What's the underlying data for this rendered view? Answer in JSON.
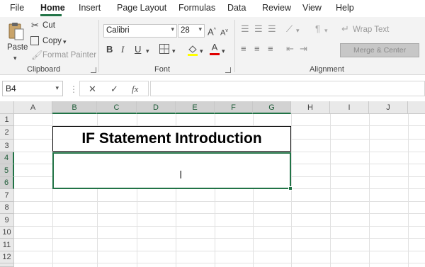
{
  "menu": {
    "tabs": [
      "File",
      "Home",
      "Insert",
      "Page Layout",
      "Formulas",
      "Data",
      "Review",
      "View",
      "Help"
    ],
    "active": "Home"
  },
  "ribbon": {
    "clipboard": {
      "paste": "Paste",
      "cut": "Cut",
      "copy": "Copy",
      "format_painter": "Format Painter",
      "label": "Clipboard"
    },
    "font": {
      "name": "Calibri",
      "size": "28",
      "bold": "B",
      "italic": "I",
      "underline": "U",
      "font_color_glyph": "A",
      "label": "Font"
    },
    "alignment": {
      "wrap_text": "Wrap Text",
      "merge_center": "Merge & Center",
      "label": "Alignment"
    }
  },
  "formula_bar": {
    "name_box": "B4",
    "cancel": "✕",
    "enter": "✓",
    "fx": "fx",
    "value": ""
  },
  "grid": {
    "columns": [
      "A",
      "B",
      "C",
      "D",
      "E",
      "F",
      "G",
      "H",
      "I",
      "J"
    ],
    "rows": [
      "1",
      "2",
      "3",
      "4",
      "5",
      "6",
      "7",
      "8",
      "9",
      "10",
      "11",
      "12"
    ],
    "title_cell_text": "IF Statement Introduction",
    "selected_columns": [
      "B",
      "C",
      "D",
      "E",
      "F",
      "G"
    ],
    "selected_rows": [
      "4",
      "5",
      "6"
    ]
  },
  "colors": {
    "accent": "#217346",
    "ribbon_bg": "#f3f3f3",
    "font_color_bar": "#e00000",
    "highlight_bar": "#ffff00"
  }
}
